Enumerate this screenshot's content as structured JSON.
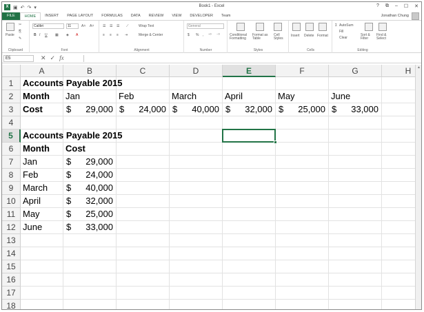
{
  "window": {
    "title": "Book1 - Excel",
    "controls": [
      "?",
      "⧉",
      "–",
      "☐",
      "✕"
    ]
  },
  "ribbon_tabs": [
    "FILE",
    "HOME",
    "INSERT",
    "PAGE LAYOUT",
    "FORMULAS",
    "DATA",
    "REVIEW",
    "VIEW",
    "DEVELOPER",
    "Team"
  ],
  "active_tab": "HOME",
  "user": {
    "name": "Jonathan Chung"
  },
  "ribbon": {
    "clipboard": {
      "label": "Clipboard",
      "paste": "Paste"
    },
    "font": {
      "label": "Font",
      "name": "Calibri",
      "size": "11",
      "bold": "B",
      "italic": "I",
      "underline": "U"
    },
    "alignment": {
      "label": "Alignment",
      "wrap": "Wrap Text",
      "merge": "Merge & Center"
    },
    "number": {
      "label": "Number",
      "format": "General",
      "currency": "$",
      "percent": "%"
    },
    "styles": {
      "label": "Styles",
      "conditional": "Conditional Formatting",
      "table": "Format as Table",
      "cell": "Cell Styles"
    },
    "cells": {
      "label": "Cells",
      "insert": "Insert",
      "delete": "Delete",
      "format": "Format"
    },
    "editing": {
      "label": "Editing",
      "autosum": "AutoSum",
      "fill": "Fill",
      "clear": "Clear",
      "sort": "Sort & Filter",
      "find": "Find & Select"
    }
  },
  "formula_bar": {
    "name_box": "E5",
    "formula": ""
  },
  "columns": [
    "A",
    "B",
    "C",
    "D",
    "E",
    "F",
    "G",
    "H"
  ],
  "rows": [
    "1",
    "2",
    "3",
    "4",
    "5",
    "6",
    "7",
    "8",
    "9",
    "10",
    "11",
    "12",
    "13",
    "14",
    "15",
    "16",
    "17",
    "18"
  ],
  "selected_cell": {
    "column": "E",
    "row": "5"
  },
  "cells": {
    "A1": "Accounts Payable 2015",
    "A2": "Month",
    "B2": "Jan",
    "C2": "Feb",
    "D2": "March",
    "E2": "April",
    "F2": "May",
    "G2": "June",
    "A3": "Cost",
    "B3": {
      "cur": "$",
      "amt": "29,000"
    },
    "C3": {
      "cur": "$",
      "amt": "24,000"
    },
    "D3": {
      "cur": "$",
      "amt": "40,000"
    },
    "E3": {
      "cur": "$",
      "amt": "32,000"
    },
    "F3": {
      "cur": "$",
      "amt": "25,000"
    },
    "G3": {
      "cur": "$",
      "amt": "33,000"
    },
    "A5": "Accounts Payable 2015",
    "A6": "Month",
    "B6": "Cost",
    "A7": "Jan",
    "B7": {
      "cur": "$",
      "amt": "29,000"
    },
    "A8": "Feb",
    "B8": {
      "cur": "$",
      "amt": "24,000"
    },
    "A9": "March",
    "B9": {
      "cur": "$",
      "amt": "40,000"
    },
    "A10": "April",
    "B10": {
      "cur": "$",
      "amt": "32,000"
    },
    "A11": "May",
    "B11": {
      "cur": "$",
      "amt": "25,000"
    },
    "A12": "June",
    "B12": {
      "cur": "$",
      "amt": "33,000"
    }
  },
  "bold_cells": [
    "A1",
    "A2",
    "A3",
    "A5",
    "A6",
    "B6"
  ],
  "accent_color": "#217346"
}
